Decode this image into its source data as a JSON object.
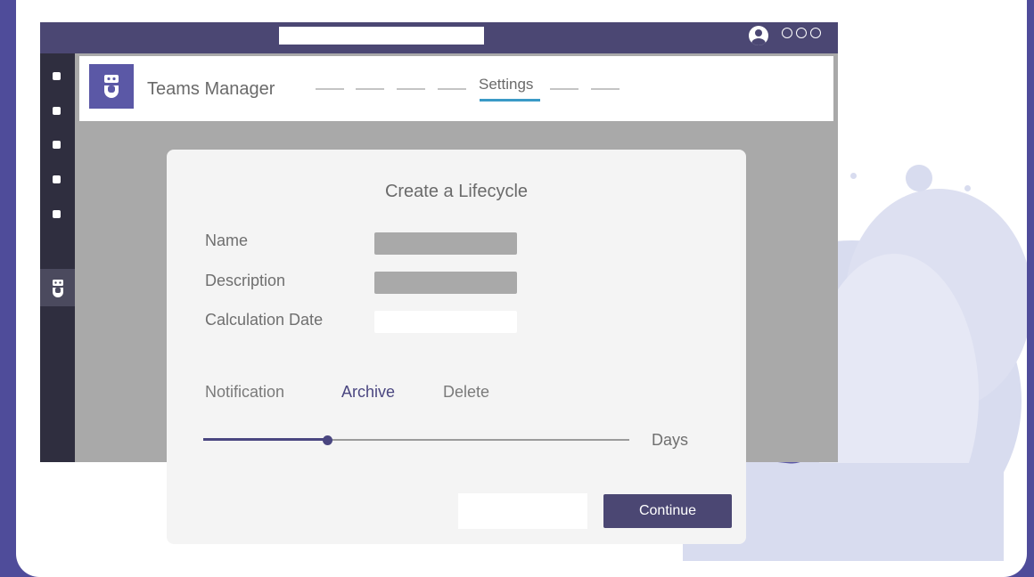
{
  "window": {
    "address_bar_value": "",
    "profile_icon": "user-circle-icon",
    "more_icon": "more-dots-icon"
  },
  "rail": {
    "items": [
      {
        "icon": "square-dot-icon"
      },
      {
        "icon": "square-dot-icon"
      },
      {
        "icon": "square-dot-icon"
      },
      {
        "icon": "square-dot-icon"
      },
      {
        "icon": "square-dot-icon"
      },
      {
        "icon": "teams-manager-bot-icon",
        "active": true
      }
    ]
  },
  "header": {
    "app_title": "Teams Manager",
    "active_tab": "Settings"
  },
  "dialog": {
    "title": "Create a Lifecycle",
    "fields": [
      {
        "label": "Name",
        "value": ""
      },
      {
        "label": "Description",
        "value": ""
      },
      {
        "label": "Calculation Date",
        "value": ""
      }
    ],
    "tabs": [
      {
        "label": "Notification",
        "active": false
      },
      {
        "label": "Archive",
        "active": true
      },
      {
        "label": "Delete",
        "active": false
      }
    ],
    "slider": {
      "fraction": 0.29,
      "unit_label": "Days"
    },
    "secondary_button_label": "",
    "continue_label": "Continue"
  },
  "colors": {
    "brand_purple": "#4b4773",
    "accent_blue": "#3a9ac6",
    "logo_purple": "#5b58a6",
    "background": "#4f4c9a"
  }
}
